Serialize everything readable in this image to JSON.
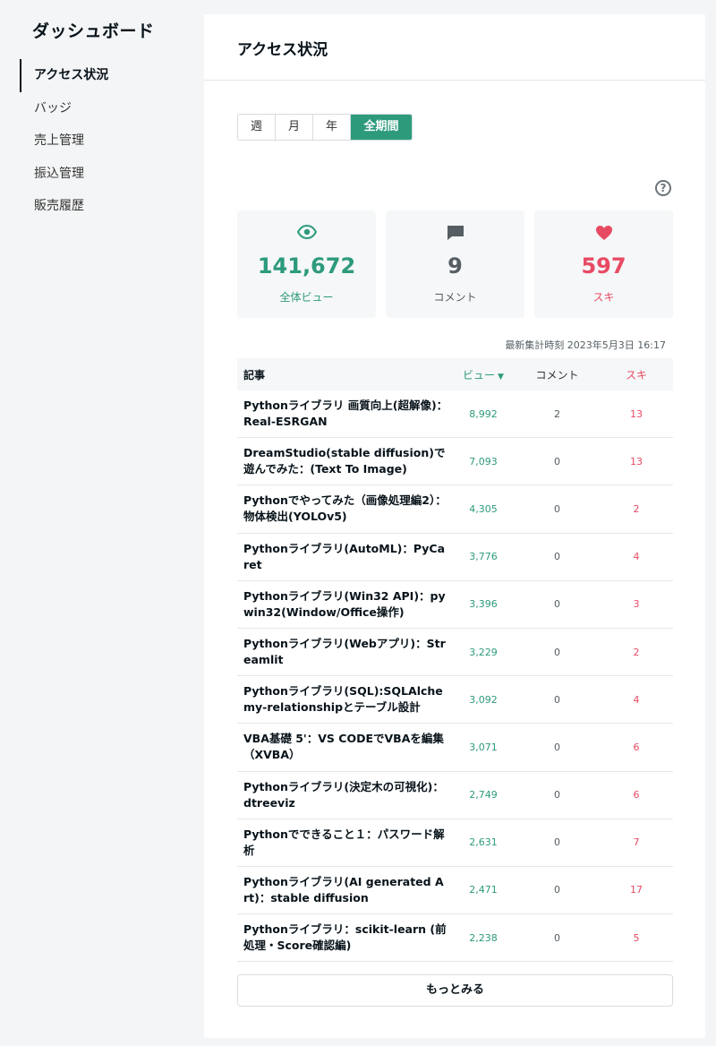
{
  "sidebar": {
    "title": "ダッシュボード",
    "items": [
      {
        "label": "アクセス状況"
      },
      {
        "label": "バッジ"
      },
      {
        "label": "売上管理"
      },
      {
        "label": "振込管理"
      },
      {
        "label": "販売履歴"
      }
    ]
  },
  "main": {
    "title": "アクセス状況",
    "tabs": [
      {
        "label": "週"
      },
      {
        "label": "月"
      },
      {
        "label": "年"
      },
      {
        "label": "全期間"
      }
    ],
    "help": "?",
    "stats": {
      "views": {
        "value": "141,672",
        "label": "全体ビュー",
        "icon": "eye-icon"
      },
      "comments": {
        "value": "9",
        "label": "コメント",
        "icon": "comment-icon"
      },
      "likes": {
        "value": "597",
        "label": "スキ",
        "icon": "heart-icon"
      }
    },
    "updated": "最新集計時刻 2023年5月3日 16:17",
    "table": {
      "headers": {
        "title": "記事",
        "views": "ビュー",
        "comments": "コメント",
        "likes": "スキ"
      },
      "rows": [
        {
          "title": "Pythonライブラリ 画質向上(超解像)：Real-ESRGAN",
          "views": "8,992",
          "comments": "2",
          "likes": "13"
        },
        {
          "title": "DreamStudio(stable diffusion)で遊んでみた：(Text To Image)",
          "views": "7,093",
          "comments": "0",
          "likes": "13"
        },
        {
          "title": "Pythonでやってみた（画像処理編2）：物体検出(YOLOv5)",
          "views": "4,305",
          "comments": "0",
          "likes": "2"
        },
        {
          "title": "Pythonライブラリ(AutoML)：PyCaret",
          "views": "3,776",
          "comments": "0",
          "likes": "4"
        },
        {
          "title": "Pythonライブラリ(Win32 API)：pywin32(Window/Office操作)",
          "views": "3,396",
          "comments": "0",
          "likes": "3"
        },
        {
          "title": "Pythonライブラリ(Webアプリ)：Streamlit",
          "views": "3,229",
          "comments": "0",
          "likes": "2"
        },
        {
          "title": "Pythonライブラリ(SQL):SQLAlchemy-relationshipとテーブル設計",
          "views": "3,092",
          "comments": "0",
          "likes": "4"
        },
        {
          "title": "VBA基礎 5'：VS CODEでVBAを編集（XVBA）",
          "views": "3,071",
          "comments": "0",
          "likes": "6"
        },
        {
          "title": "Pythonライブラリ(決定木の可視化)：dtreeviz",
          "views": "2,749",
          "comments": "0",
          "likes": "6"
        },
        {
          "title": "Pythonでできること１：パスワード解析",
          "views": "2,631",
          "comments": "0",
          "likes": "7"
        },
        {
          "title": "Pythonライブラリ(AI generated Art)：stable diffusion",
          "views": "2,471",
          "comments": "0",
          "likes": "17"
        },
        {
          "title": "Pythonライブラリ：scikit-learn (前処理・Score確認編)",
          "views": "2,238",
          "comments": "0",
          "likes": "5"
        }
      ]
    },
    "more_label": "もっとみる"
  },
  "colors": {
    "accent_green": "#2d9a7c",
    "like_red": "#e84a63",
    "text_dark": "#08131a"
  }
}
